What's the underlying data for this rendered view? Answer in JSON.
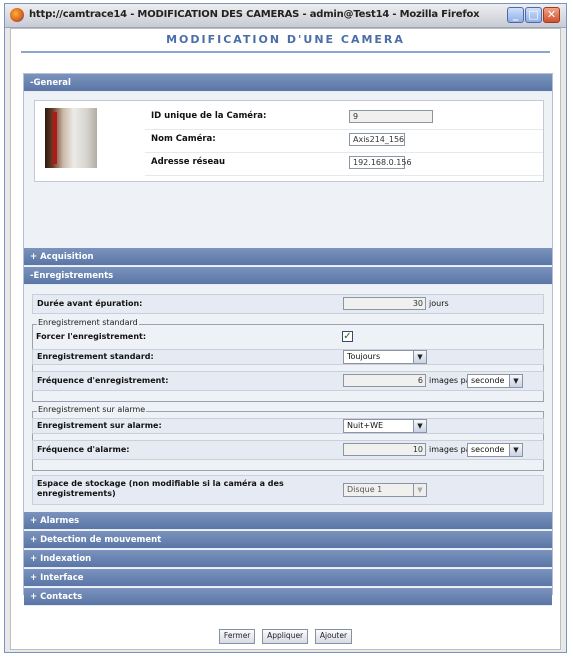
{
  "window": {
    "title": "http://camtrace14 - MODIFICATION DES CAMERAS - admin@Test14 - Mozilla Firefox",
    "minimize": "_",
    "maximize": "□",
    "close": "✕"
  },
  "page": {
    "title": "MODIFICATION D'UNE CAMERA"
  },
  "general": {
    "header": "-General",
    "rows": [
      {
        "label": "ID unique de la Caméra:",
        "value": "9"
      },
      {
        "label": "Nom Caméra:",
        "value": "Axis214_156"
      },
      {
        "label": "Adresse réseau",
        "value": "192.168.0.156"
      }
    ]
  },
  "acquisition": {
    "header": "+ Acquisition"
  },
  "enregistrements": {
    "header": "-Enregistrements",
    "duree": {
      "label": "Durée avant épuration:",
      "value": "30",
      "unit": "jours"
    },
    "standard": {
      "legend": "Enregistrement standard",
      "forcer_label": "Forcer l'enregistrement:",
      "forcer_checked": true,
      "mode_label": "Enregistrement standard:",
      "mode_value": "Toujours",
      "freq_label": "Fréquence d'enregistrement:",
      "freq_value": "6",
      "freq_unit": "images par",
      "freq_per": "seconde"
    },
    "alarme": {
      "legend": "Enregistrement sur alarme",
      "mode_label": "Enregistrement sur alarme:",
      "mode_value": "Nuit+WE",
      "freq_label": "Fréquence d'alarme:",
      "freq_value": "10",
      "freq_unit": "images par",
      "freq_per": "seconde"
    },
    "storage": {
      "label": "Espace de stockage (non modifiable si la caméra a des enregistrements)",
      "value": "Disque 1"
    }
  },
  "collapsed_sections": [
    "+ Alarmes",
    "+ Detection de mouvement",
    "+ Indexation",
    "+ Interface",
    "+ Contacts"
  ],
  "buttons": {
    "fermer": "Fermer",
    "appliquer": "Appliquer",
    "ajouter": "Ajouter"
  }
}
